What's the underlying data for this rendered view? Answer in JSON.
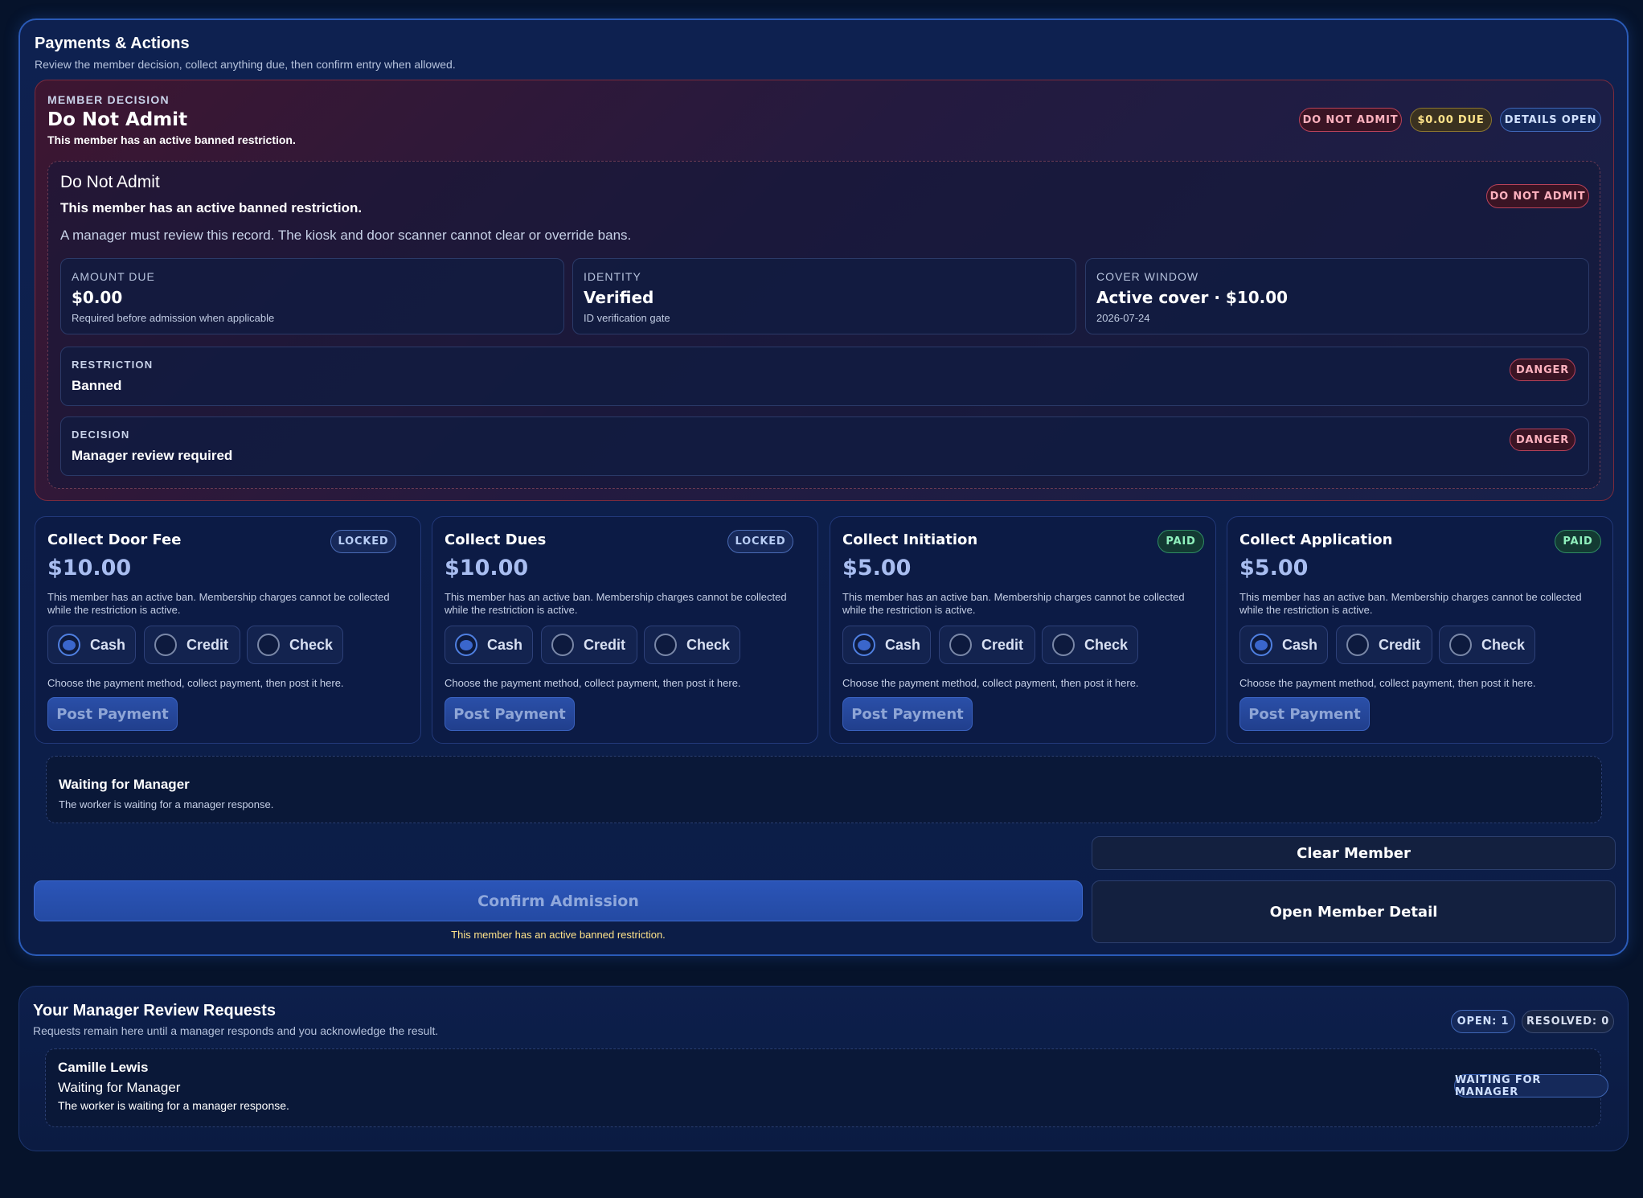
{
  "payments": {
    "title": "Payments & Actions",
    "subtitle": "Review the member decision, collect anything due, then confirm entry when allowed."
  },
  "decision": {
    "eyebrow": "MEMBER DECISION",
    "title": "Do Not Admit",
    "reason": "This member has an active banned restriction.",
    "badges": [
      "DO NOT ADMIT",
      "$0.00 DUE",
      "DETAILS OPEN"
    ],
    "detail": {
      "title": "Do Not Admit",
      "reason": "This member has an active banned restriction.",
      "note": "A manager must review this record. The kiosk and door scanner cannot clear or override bans.",
      "badge": "DO NOT ADMIT"
    },
    "stats": [
      {
        "label": "AMOUNT DUE",
        "value": "$0.00",
        "note": "Required before admission when applicable"
      },
      {
        "label": "IDENTITY",
        "value": "Verified",
        "note": "ID verification gate"
      },
      {
        "label": "COVER WINDOW",
        "value": "Active cover · $10.00",
        "note": "2026-07-24"
      }
    ],
    "restriction": {
      "label": "RESTRICTION",
      "value": "Banned",
      "badge": "DANGER"
    },
    "decision_row": {
      "label": "DECISION",
      "value": "Manager review required",
      "badge": "DANGER"
    }
  },
  "collect": [
    {
      "title": "Collect Door Fee",
      "status": "LOCKED",
      "amount": "$10.00"
    },
    {
      "title": "Collect Dues",
      "status": "LOCKED",
      "amount": "$10.00"
    },
    {
      "title": "Collect Initiation",
      "status": "PAID",
      "amount": "$5.00"
    },
    {
      "title": "Collect Application",
      "status": "PAID",
      "amount": "$5.00"
    }
  ],
  "collect_common": {
    "desc": "This member has an active ban. Membership charges cannot be collected while the restriction is active.",
    "methods": [
      "Cash",
      "Credit",
      "Check"
    ],
    "selected_method": "Cash",
    "help": "Choose the payment method, collect payment, then post it here.",
    "post_label": "Post Payment"
  },
  "waiting": {
    "title": "Waiting for Manager",
    "note": "The worker is waiting for a manager response."
  },
  "actions": {
    "clear_label": "Clear Member",
    "detail_label": "Open Member Detail",
    "confirm_label": "Confirm Admission",
    "confirm_note": "This member has an active banned restriction."
  },
  "requests": {
    "title": "Your Manager Review Requests",
    "subtitle": "Requests remain here until a manager responds and you acknowledge the result.",
    "open_badge": "OPEN: 1",
    "resolved_badge": "RESOLVED: 0",
    "item": {
      "name": "Camille Lewis",
      "status_title": "Waiting for Manager",
      "note": "The worker is waiting for a manager response.",
      "badge": "WAITING FOR MANAGER"
    }
  },
  "colors": {
    "accent": "#2a5bb8",
    "danger": "#b8425a",
    "paid": "#2f8c63",
    "warning_text": "#ffe38a"
  }
}
